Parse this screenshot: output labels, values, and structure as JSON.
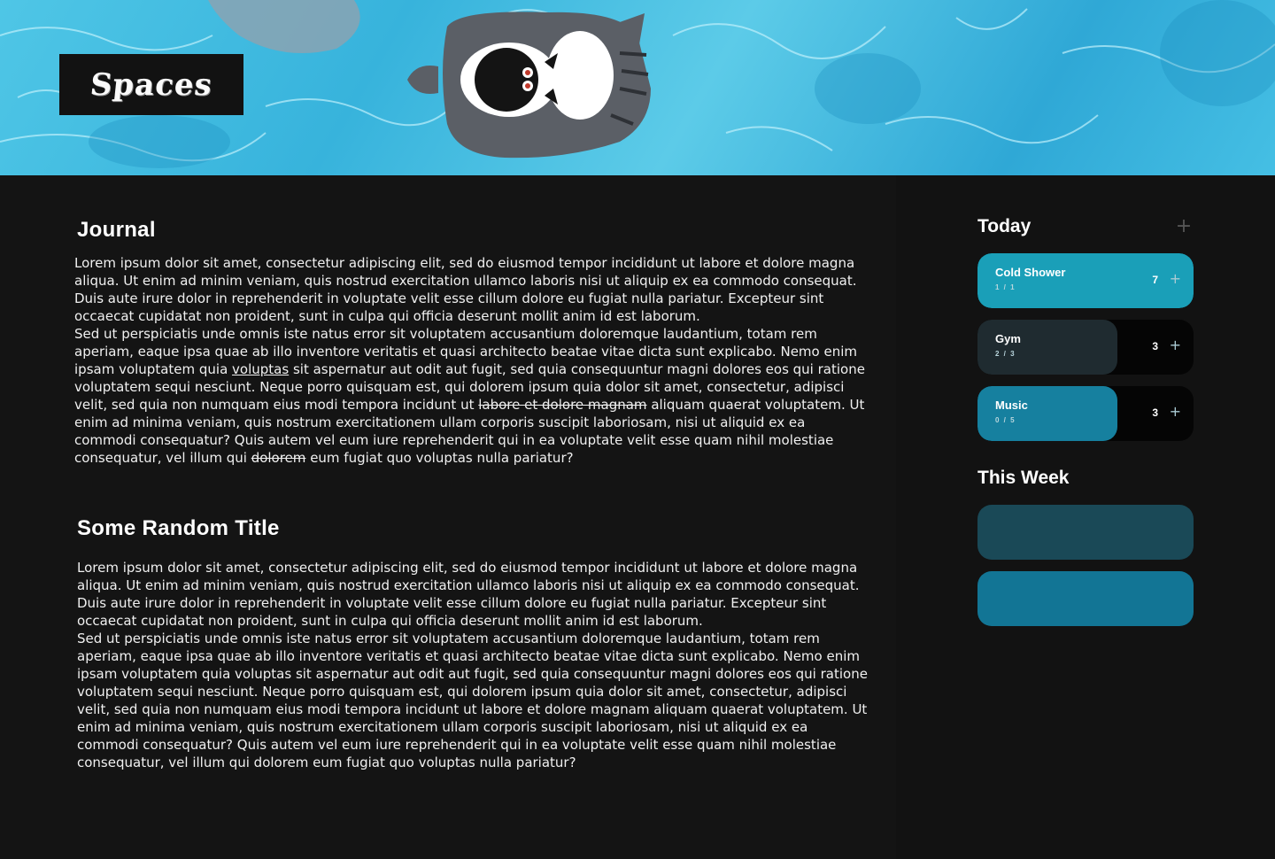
{
  "header": {
    "brand_title": "Spaces",
    "banner_image": "cats-floating-in-pool-illustration"
  },
  "journal": {
    "title": "Journal",
    "paragraph1": "Lorem ipsum dolor sit amet, consectetur adipiscing elit, sed do eiusmod tempor incididunt ut labore et dolore magna aliqua. Ut enim ad minim veniam, quis nostrud exercitation ullamco laboris nisi ut aliquip ex ea commodo consequat. Duis aute irure dolor in reprehenderit in voluptate velit esse cillum dolore eu fugiat nulla pariatur. Excepteur sint occaecat cupidatat non proident, sunt in culpa qui officia deserunt mollit anim id est laborum.",
    "p2_a": "Sed ut perspiciatis unde omnis iste natus error sit voluptatem accusantium doloremque laudantium, totam rem aperiam, eaque ipsa quae ab illo inventore veritatis et quasi architecto beatae vitae dicta sunt explicabo. Nemo enim ipsam voluptatem quia ",
    "p2_link": "voluptas",
    "p2_b": " sit aspernatur aut odit aut fugit, sed quia consequuntur magni dolores eos qui ratione voluptatem sequi nesciunt. Neque porro quisquam est, qui dolorem ipsum quia dolor sit amet, consectetur, adipisci velit, sed quia non numquam eius modi tempora incidunt ut ",
    "p2_strike1": "labore et dolore magnam",
    "p2_c": " aliquam quaerat voluptatem. Ut enim ad minima veniam, quis nostrum exercitationem ullam corporis suscipit laboriosam, nisi ut aliquid ex ea commodi consequatur? Quis autem vel eum iure reprehenderit qui in ea voluptate velit esse quam nihil molestiae consequatur, vel illum qui ",
    "p2_strike2": "dolorem",
    "p2_d": " eum fugiat quo voluptas nulla pariatur?"
  },
  "section2": {
    "title": "Some Random Title",
    "paragraph1": "Lorem ipsum dolor sit amet, consectetur adipiscing elit, sed do eiusmod tempor incididunt ut labore et dolore magna aliqua. Ut enim ad minim veniam, quis nostrud exercitation ullamco laboris nisi ut aliquip ex ea commodo consequat. Duis aute irure dolor in reprehenderit in voluptate velit esse cillum dolore eu fugiat nulla pariatur. Excepteur sint occaecat cupidatat non proident, sunt in culpa qui officia deserunt mollit anim id est laborum.",
    "paragraph2": "Sed ut perspiciatis unde omnis iste natus error sit voluptatem accusantium doloremque laudantium, totam rem aperiam, eaque ipsa quae ab illo inventore veritatis et quasi architecto beatae vitae dicta sunt explicabo. Nemo enim ipsam voluptatem quia voluptas sit aspernatur aut odit aut fugit, sed quia consequuntur magni dolores eos qui ratione voluptatem sequi nesciunt. Neque porro quisquam est, qui dolorem ipsum quia dolor sit amet, consectetur, adipisci velit, sed quia non numquam eius modi tempora incidunt ut labore et dolore magnam aliquam quaerat voluptatem. Ut enim ad minima veniam, quis nostrum exercitationem ullam corporis suscipit laboriosam, nisi ut aliquid ex ea commodi consequatur? Quis autem vel eum iure reprehenderit qui in ea voluptate velit esse quam nihil molestiae consequatur, vel illum qui dolorem eum fugiat quo voluptas nulla pariatur?"
  },
  "today": {
    "title": "Today",
    "add_icon": "plus-icon",
    "habits": [
      {
        "name": "Cold Shower",
        "progress": "1 / 1",
        "streak": "7",
        "done": 1,
        "total": 1,
        "color": "#1a9fb8"
      },
      {
        "name": "Gym",
        "progress": "2 / 3",
        "streak": "3",
        "done": 2,
        "total": 3,
        "color": "#1f2b30"
      },
      {
        "name": "Music",
        "progress": "0 / 5",
        "streak": "3",
        "done": 0,
        "total": 5,
        "color": "#16809f"
      }
    ]
  },
  "this_week": {
    "title": "This Week",
    "cards": [
      {
        "color": "#1a4957"
      },
      {
        "color": "#127595"
      }
    ]
  }
}
